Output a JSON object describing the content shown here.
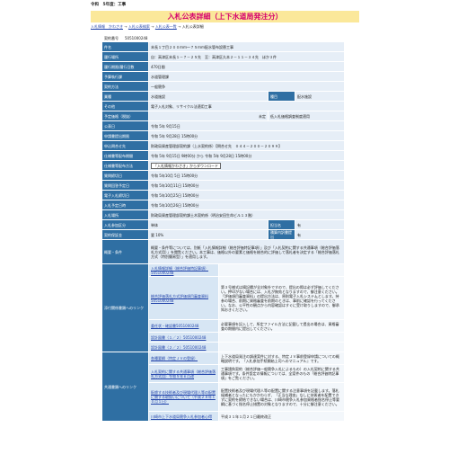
{
  "header": {
    "top_line": "令和　5年度：工事",
    "title": "入札公表詳細（上下水道局発注分）"
  },
  "breadcrumb": [
    "入札情報　かわさき",
    "入札公表検索",
    "入札公表一覧",
    "入札公表詳細"
  ],
  "contract_no": {
    "label": "契約番号",
    "value": "5051000248"
  },
  "rows": {
    "name": {
      "label": "件名",
      "value": "末長１丁目２００ｍｍ～７５ｍｍ配水管布設替工事"
    },
    "place": {
      "label": "履行場所",
      "value": "自：高津区末長１－７－２５先　至：高津区久本２－１１－３４先　ほか３件"
    },
    "period": {
      "label": "履行期限/履行日数",
      "value": "470日間"
    },
    "category": {
      "label": "予算執行課",
      "value": "水道管理課"
    },
    "method": {
      "label": "契約方法",
      "value": "一般競争"
    },
    "kind": {
      "label": "業種",
      "value": "水道施設",
      "label2": "種目",
      "value2": "配水施設"
    },
    "other": {
      "label": "その他",
      "value": "電子入札対象、リサイクル法適用工事"
    },
    "price": {
      "label": "予定価格（税抜）",
      "value_mid": "未定",
      "value": "低入札価格調査制度適用"
    },
    "pub_date": {
      "label": "公表日",
      "value": "令和 5年 9月15日"
    },
    "app_deadline": {
      "label": "申請書提出期限",
      "value": "令和 5年 9月28日 15時00分"
    },
    "contact": {
      "label": "申込問合せ先",
      "value": "財政局資産管理部契約課（上水契約係）【問合せ先　０４４－２００－２０９９】"
    },
    "doc_period": {
      "label": "仕様書等配布期間",
      "value": "令和 5年 9月15日 9時00分 から 令和 5年 9月28日 15時00分"
    },
    "doc_method": {
      "label": "仕様書等配布方法",
      "value_box": "「入札情報かわさき」からダウンロード"
    },
    "question_deadline": {
      "label": "質問締切日",
      "value": "令和 5年10月 5日 15時00分"
    },
    "answer_date": {
      "label": "質問回答予定日",
      "value": "令和 5年10月11日 15時00分"
    },
    "bid_deadline": {
      "label": "電子入札締切日",
      "value": "令和 5年10月25日 15時00分"
    },
    "open_date": {
      "label": "入札予定日時",
      "value": "令和 5年10月26日 15時00分"
    },
    "place2": {
      "label": "入札場所",
      "value": "財政局資産管理部契約課土木契約係（明治安田生命ビル１３階）"
    },
    "jv": {
      "label": "入札参加区分",
      "value": "単体",
      "label2": "担当名",
      "value2": "有"
    },
    "jv2": {
      "label": "契約保証金",
      "value": "要 10%",
      "label2": "積算内訳書提出",
      "value2": "有"
    },
    "summary": {
      "label": "概要・条件",
      "value": "概要・条件等については、別紙「入札情報詳細（総合評価特記事項）」及び「入札契約に関する共通事項（総合評価落札方式用）」を閲覧ください。本工事は、価格以外の要素と価格を総合的に評価して落札者を決定する「総合評価落札方式（特別簡易型）」を適用します。"
    }
  },
  "attachments": {
    "label": "添付関係書類へのリンク",
    "items": [
      {
        "link": "入札情報詳細（総合評価特記事項）5051000248",
        "desc": ""
      },
      {
        "link": "総合評価落札方式評価項目審査資料 5051000248",
        "desc": "第３号様式は摘記欄が全対象外ですので、提出の際は必ず評価してください。押印がない場合には、入札が無効となりますので、御注意ください。「評価項目審査資料」の提出方法は、原則電子入札システムとします。持参の場合、前期に資格審査を前期のときは、事前に確認を行ってください。なお、公平性の観点から内容確認はすぐに受け取りしますので、御承知おきください。"
      },
      {
        "link": "委任状・確認書5051000248",
        "desc": "必要事項を記入して、所定ファイル方法に記載して提出の場合は、資格審査の期間内に提出してください。"
      },
      {
        "link": "設計図書（１／２）5051000248",
        "desc": ""
      },
      {
        "link": "設計図書（２／２）5051000248",
        "desc": ""
      }
    ]
  },
  "common": {
    "label": "共通書類へのリンク",
    "items": [
      {
        "link": "各種要綱（特定ＪＶの登録）",
        "desc": "上下水道局発注の調達案件に対する、特定ＪＶ事前登録申請についての概略説明です。『入札参加手続開始上司へのマニュアル』です。"
      },
      {
        "link": "入札契約に関する共通事項（総合評価落札方式用）令和５年６月改",
        "desc": "工事請負契約（総合評価一般競争入札によるもの）の入札契約に関する共通事項です。条件設定の情報については、全案件のもの「総合評価特記事項」をご覧ください。"
      },
      {
        "link": "配慮する技術者及び現場代理人等の配置に関する取扱いについて（平成２８年１０月１日）",
        "desc": "配置技術者及び現場代理人等の配置に関する注意事項を記載します。落札候補者となったにもかかわらず、「正当な理由」なしに技術者を配置できずに契約を締結できない場合は、川崎市競争入札参加資格者指名停止等要綱に基づく指名停止措置の対象となりますので、十分に御注意ください。"
      },
      {
        "link": "川崎市上下水道局競争入札参加者心得",
        "desc": "平成３１年１月２１日最終改正"
      }
    ]
  }
}
